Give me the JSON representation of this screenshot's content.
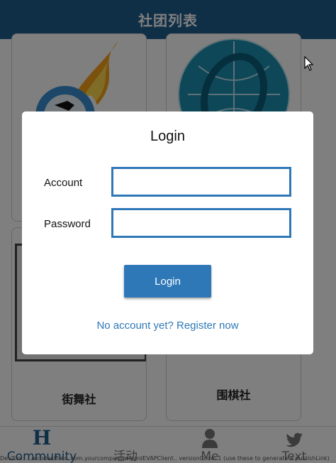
{
  "header": {
    "title": "社团列表"
  },
  "clubs": [
    {
      "name": ""
    },
    {
      "name": ""
    },
    {
      "name": "街舞社"
    },
    {
      "name": "围棋社"
    }
  ],
  "tabbar": {
    "items": [
      {
        "label": "Community",
        "icon": "h-logo-icon",
        "active": true
      },
      {
        "label": "活动",
        "icon": ""
      },
      {
        "label": "Me",
        "icon": "person-icon"
      },
      {
        "label": "Text",
        "icon": "twitter-bird-icon"
      }
    ]
  },
  "debug_text": "DevTool: .../ecodes/files .com.yourcompany.wizardEVAPClient.. versionCode: 1 (use these to generate a publishLink)",
  "login_dialog": {
    "title": "Login",
    "account_label": "Account",
    "account_value": "",
    "password_label": "Password",
    "password_value": "",
    "submit_label": "Login",
    "register_link": "No account yet? Register now"
  },
  "colors": {
    "primary": "#2e78b7",
    "header": "#1f5f8f",
    "overlay": "rgba(0,0,0,0.5)"
  }
}
